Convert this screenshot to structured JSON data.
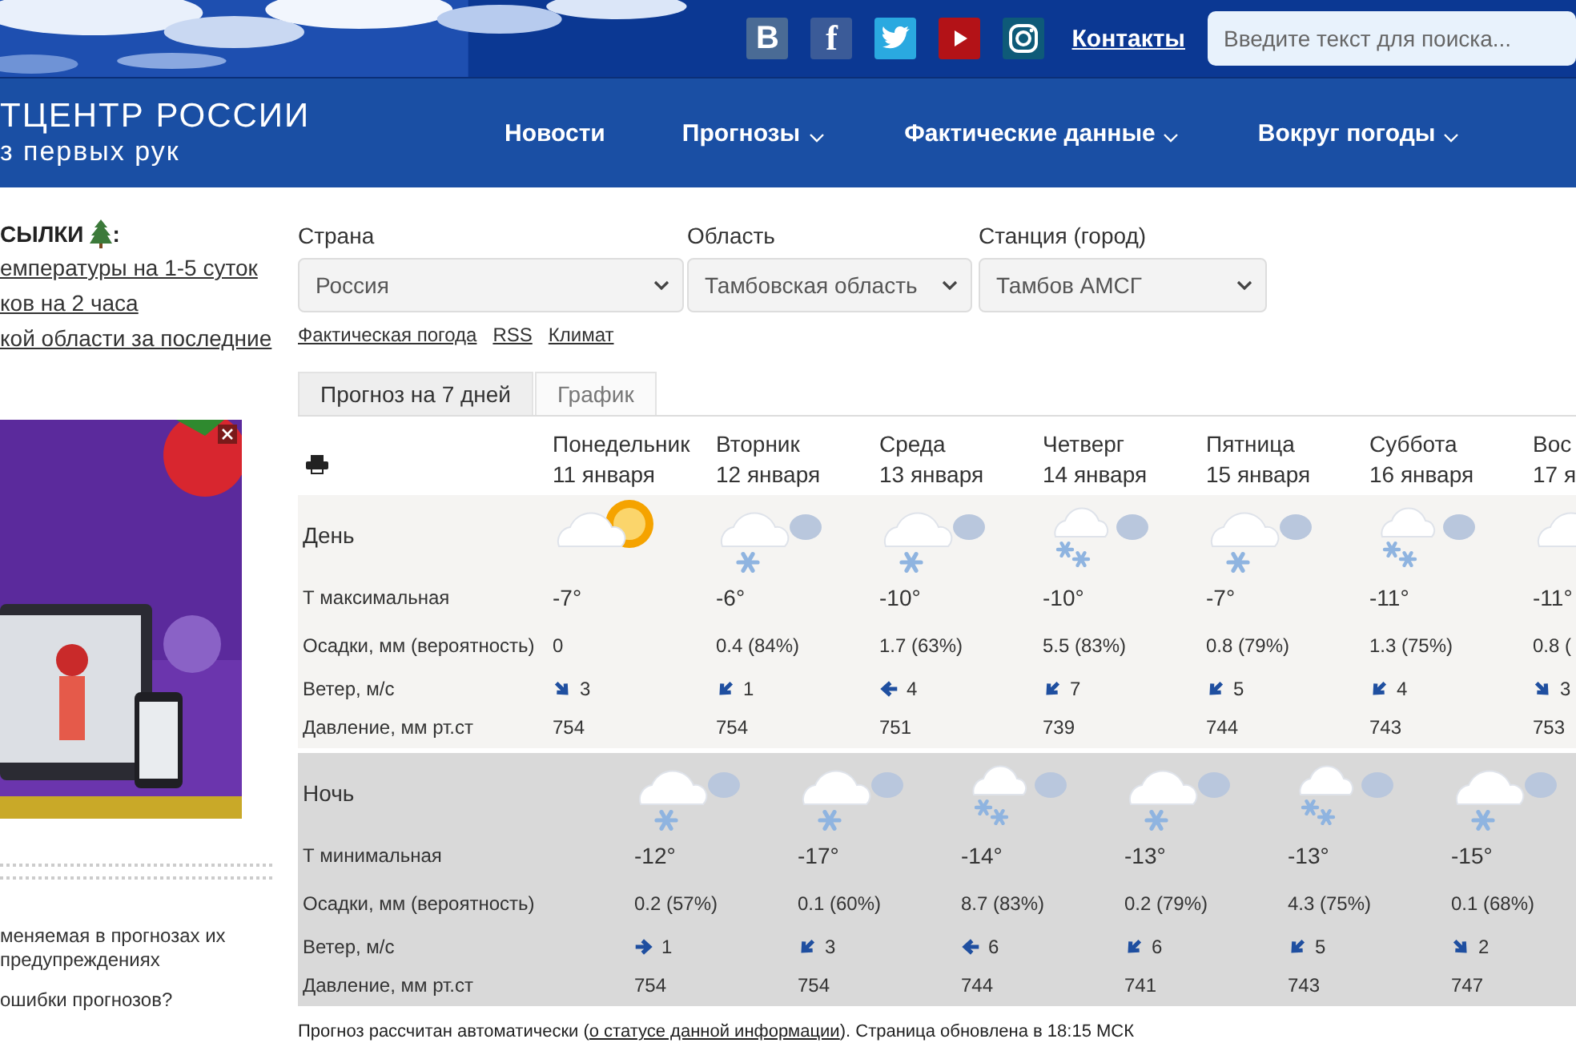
{
  "topbar": {
    "socials": [
      {
        "kind": "vk",
        "glyph": "B"
      },
      {
        "kind": "facebook",
        "glyph": "f"
      },
      {
        "kind": "twitter"
      },
      {
        "kind": "youtube"
      },
      {
        "kind": "instagram"
      }
    ],
    "contacts_link": "Контакты",
    "search": {
      "placeholder": "Введите текст для поиска..."
    }
  },
  "logo": {
    "line_1": "ТЦЕНТР РОССИИ",
    "line_2": "з первых рук"
  },
  "nav": [
    {
      "label": "Новости",
      "dropdown": false
    },
    {
      "label": "Прогнозы",
      "dropdown": true
    },
    {
      "label": "Фактические данные",
      "dropdown": true
    },
    {
      "label": "Вокруг погоды",
      "dropdown": true
    }
  ],
  "sidebar": {
    "title": "СЫЛКИ",
    "title_suffix": ":",
    "links": [
      "емпературы на 1-5 суток",
      "ков на 2 часа",
      "кой области за последние"
    ],
    "ad": {
      "kind": "picture"
    },
    "notes": [
      "меняемая в прогнозах их предупреждениях",
      "ошибки прогнозов?"
    ]
  },
  "filters": [
    {
      "label": "Страна",
      "value": "Россия"
    },
    {
      "label": "Область",
      "value": "Тамбовская область"
    },
    {
      "label": "Станция (город)",
      "value": "Тамбов АМСГ"
    }
  ],
  "links": [
    "Фактическая погода",
    "RSS",
    "Климат"
  ],
  "tabs": [
    {
      "label": "Прогноз на 7 дней",
      "selected": true
    },
    {
      "label": "График",
      "selected": false
    }
  ],
  "forecast": {
    "day_label": "День",
    "night_label": "Ночь",
    "day_rows": [
      "Т максимальная",
      "Осадки, мм (вероятность)",
      "Ветер, м/с",
      "Давление, мм рт.ст"
    ],
    "night_rows": [
      "Т минимальная",
      "Осадки, мм (вероятность)",
      "Ветер, м/с",
      "Давление, мм рт.ст"
    ],
    "days": [
      {
        "name": "Понедельник",
        "date": "11 января",
        "weather": {
          "kind": "sun_cloud"
        },
        "t": "-7°",
        "precip": "0",
        "wind": {
          "kind": "se",
          "speed": "3"
        },
        "pressure": "754"
      },
      {
        "name": "Вторник",
        "date": "12 января",
        "weather": {
          "kind": "snow"
        },
        "t": "-6°",
        "precip": "0.4 (84%)",
        "wind": {
          "kind": "sw",
          "speed": "1"
        },
        "pressure": "754"
      },
      {
        "name": "Среда",
        "date": "13 января",
        "weather": {
          "kind": "snow"
        },
        "t": "-10°",
        "precip": "1.7 (63%)",
        "wind": {
          "kind": "w",
          "speed": "4"
        },
        "pressure": "751"
      },
      {
        "name": "Четверг",
        "date": "14 января",
        "weather": {
          "kind": "light_snow"
        },
        "t": "-10°",
        "precip": "5.5 (83%)",
        "wind": {
          "kind": "sw",
          "speed": "7"
        },
        "pressure": "739"
      },
      {
        "name": "Пятница",
        "date": "15 января",
        "weather": {
          "kind": "snow"
        },
        "t": "-7°",
        "precip": "0.8 (79%)",
        "wind": {
          "kind": "sw",
          "speed": "5"
        },
        "pressure": "744"
      },
      {
        "name": "Суббота",
        "date": "16 января",
        "weather": {
          "kind": "light_snow"
        },
        "t": "-11°",
        "precip": "1.3 (75%)",
        "wind": {
          "kind": "sw",
          "speed": "4"
        },
        "pressure": "743"
      },
      {
        "name": "Вос",
        "date": "17 я",
        "weather": {
          "kind": "cloud"
        },
        "t": "-11°",
        "precip": "0.8 (",
        "wind": {
          "kind": "se",
          "speed": "3"
        },
        "pressure": "753"
      }
    ],
    "nights": [
      {
        "weather": {
          "kind": "snow"
        },
        "t": "-12°",
        "precip": "0.2 (57%)",
        "wind": {
          "kind": "e",
          "speed": "1"
        },
        "pressure": "754"
      },
      {
        "weather": {
          "kind": "snow"
        },
        "t": "-17°",
        "precip": "0.1 (60%)",
        "wind": {
          "kind": "sw",
          "speed": "3"
        },
        "pressure": "754"
      },
      {
        "weather": {
          "kind": "light_snow"
        },
        "t": "-14°",
        "precip": "8.7 (83%)",
        "wind": {
          "kind": "w",
          "speed": "6"
        },
        "pressure": "744"
      },
      {
        "weather": {
          "kind": "snow"
        },
        "t": "-13°",
        "precip": "0.2 (79%)",
        "wind": {
          "kind": "sw",
          "speed": "6"
        },
        "pressure": "741"
      },
      {
        "weather": {
          "kind": "light_snow"
        },
        "t": "-13°",
        "precip": "4.3 (75%)",
        "wind": {
          "kind": "sw",
          "speed": "5"
        },
        "pressure": "743"
      },
      {
        "weather": {
          "kind": "snow"
        },
        "t": "-15°",
        "precip": "0.1 (68%)",
        "wind": {
          "kind": "se",
          "speed": "2"
        },
        "pressure": "747"
      }
    ]
  },
  "footer": {
    "before": "Прогноз рассчитан автоматически (",
    "link": "о статусе данной информации",
    "after": "). Страница обновлена в 18:15 МСК"
  }
}
